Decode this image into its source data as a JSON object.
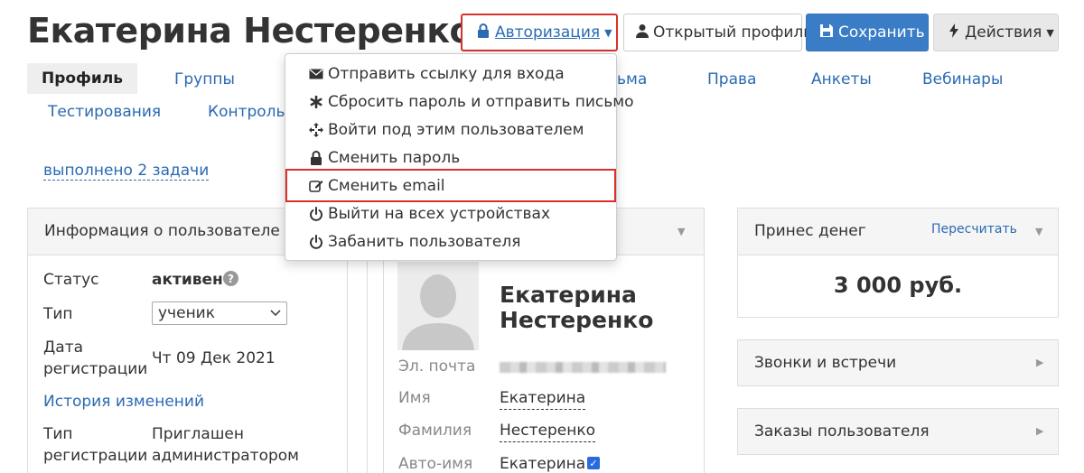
{
  "header": {
    "title": "Екатерина Нестеренко",
    "auth_label": "Авторизация",
    "profile_label": "Открытый профиль",
    "save_label": "Сохранить",
    "actions_label": "Действия"
  },
  "tabs": [
    {
      "label": "Профиль"
    },
    {
      "label": "Группы"
    },
    {
      "label": "ьма"
    },
    {
      "label": "Права"
    },
    {
      "label": "Анкеты"
    },
    {
      "label": "Вебинары"
    },
    {
      "label": "Тестирования"
    },
    {
      "label": "Контроль к"
    }
  ],
  "tasks_link": "выполнено 2 задачи",
  "info_panel": {
    "title": "Информация о пользователе",
    "status_label": "Статус",
    "status_value": "активен",
    "help": "?",
    "type_label": "Тип",
    "type_value": "ученик",
    "date_label_1": "Дата",
    "date_label_2": "регистрации",
    "date_value": "Чт 09 Дек 2021",
    "history_link": "История изменений",
    "reg_type_label_1": "Тип",
    "reg_type_label_2": "регистрации",
    "reg_type_value_1": "Приглашен",
    "reg_type_value_2": "администратором"
  },
  "profile_card": {
    "name_line1": "Екатерина",
    "name_line2": "Нестеренко",
    "email_label": "Эл. почта",
    "first_name_label": "Имя",
    "first_name_value": "Екатерина",
    "last_name_label": "Фамилия",
    "last_name_value": "Нестеренко",
    "auto_name_label": "Авто-имя",
    "auto_name_value": "Екатерина"
  },
  "money_panel": {
    "title": "Принес денег",
    "recalc_label": "Пересчитать",
    "amount": "3 000 руб."
  },
  "calls_panel": {
    "title": "Звонки и встречи"
  },
  "orders_panel": {
    "title": "Заказы пользователя"
  },
  "auth_menu": [
    {
      "label": "Отправить ссылку для входа",
      "icon": "envelope-icon"
    },
    {
      "label": "Сбросить пароль и отправить письмо",
      "icon": "asterisk-icon"
    },
    {
      "label": "Войти под этим пользователем",
      "icon": "move-icon"
    },
    {
      "label": "Сменить пароль",
      "icon": "lock-icon"
    },
    {
      "label": "Сменить email",
      "icon": "edit-icon"
    },
    {
      "label": "Выйти на всех устройствах",
      "icon": "power-icon"
    },
    {
      "label": "Забанить пользователя",
      "icon": "power-icon"
    }
  ],
  "colors": {
    "link": "#2a6ab3",
    "primary": "#3a7dc6",
    "highlight": "#d9302b"
  }
}
